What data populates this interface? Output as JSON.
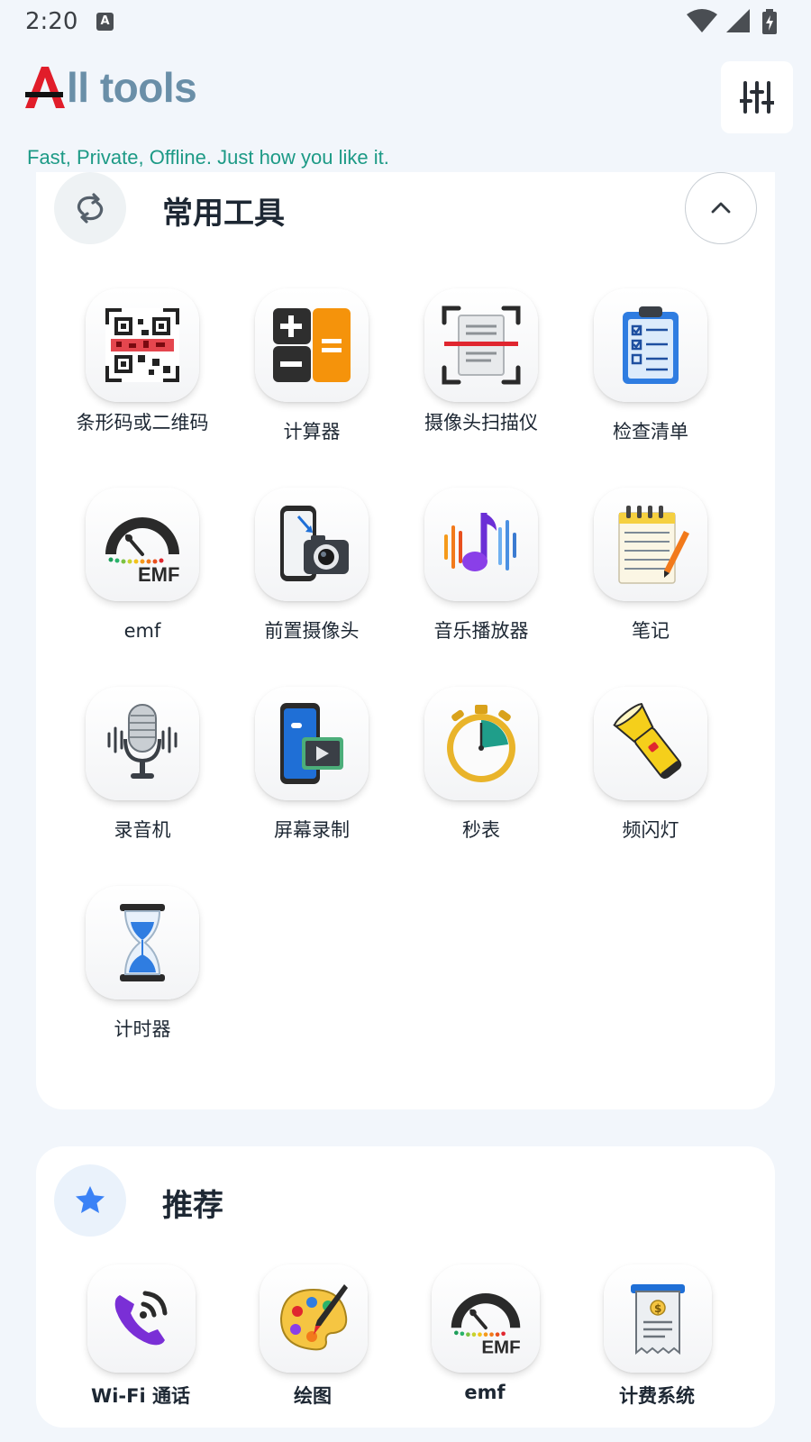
{
  "status_bar": {
    "time": "2:20",
    "notification_glyph": "A"
  },
  "header": {
    "title_letter": "A",
    "title_rest": "ll tools",
    "tagline": "Fast, Private, Offline. Just how you like it.",
    "settings_icon": "sliders-icon"
  },
  "common_tools": {
    "title": "常用工具",
    "icon": "refresh-icon",
    "collapse_icon": "chevron-up-icon",
    "tools": [
      {
        "label": "条形码或二维码",
        "icon": "qr-code-icon"
      },
      {
        "label": "计算器",
        "icon": "calculator-icon"
      },
      {
        "label": "摄像头扫描仪",
        "icon": "document-scanner-icon"
      },
      {
        "label": "检查清单",
        "icon": "checklist-icon"
      },
      {
        "label": "emf",
        "icon": "emf-meter-icon"
      },
      {
        "label": "前置摄像头",
        "icon": "front-camera-icon"
      },
      {
        "label": "音乐播放器",
        "icon": "music-note-icon"
      },
      {
        "label": "笔记",
        "icon": "notepad-icon"
      },
      {
        "label": "录音机",
        "icon": "microphone-icon"
      },
      {
        "label": "屏幕录制",
        "icon": "screen-record-icon"
      },
      {
        "label": "秒表",
        "icon": "stopwatch-icon"
      },
      {
        "label": "频闪灯",
        "icon": "flashlight-icon"
      },
      {
        "label": "计时器",
        "icon": "hourglass-icon"
      }
    ]
  },
  "recommended": {
    "title": "推荐",
    "icon": "star-icon",
    "items": [
      {
        "label": "Wi-Fi 通话",
        "icon": "wifi-call-icon"
      },
      {
        "label": "绘图",
        "icon": "paint-palette-icon"
      },
      {
        "label": "emf",
        "icon": "emf-meter-icon"
      },
      {
        "label": "计费系统",
        "icon": "receipt-icon"
      }
    ]
  },
  "colors": {
    "background": "#f2f6fb",
    "title": "#6a8fa8",
    "tagline": "#1d9a86",
    "logo_red": "#e11d2a",
    "star_blue": "#3b82f6"
  }
}
